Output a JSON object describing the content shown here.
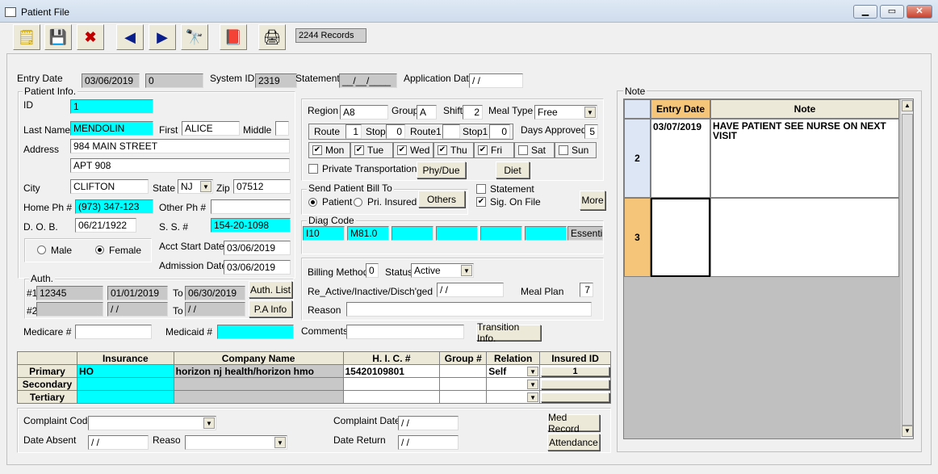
{
  "window": {
    "title": "Patient File",
    "min": "▭",
    "max": "□",
    "close": "✕"
  },
  "toolbar": {
    "records": "2244 Records"
  },
  "header": {
    "entry_date_label": "Entry Date",
    "entry_date": "03/06/2019",
    "entry_extra": "0",
    "system_id_label": "System ID",
    "system_id": "2319",
    "statement_label": "Statement",
    "statement": "__/__/____",
    "application_date_label": "Application Date",
    "application_date": " / /"
  },
  "patient": {
    "group_label": "Patient Info.",
    "id_label": "ID",
    "id": "1",
    "last_name_label": "Last Name",
    "last_name": "MENDOLIN",
    "first_label": "First",
    "first": "ALICE",
    "middle_label": "Middle",
    "middle": "",
    "address_label": "Address",
    "address1": "984 MAIN STREET",
    "address2": "APT 908",
    "city_label": "City",
    "city": "CLIFTON",
    "state_label": "State",
    "state": "NJ",
    "zip_label": "Zip",
    "zip": "07512",
    "home_ph_label": "Home Ph #",
    "home_ph": "(973) 347-123",
    "other_ph_label": "Other Ph #",
    "other_ph": "",
    "dob_label": "D. O. B.",
    "dob": "06/21/1922",
    "ss_label": "S. S. #",
    "ss": "154-20-1098",
    "male_label": "Male",
    "female_label": "Female",
    "acct_start_label": "Acct Start Date",
    "acct_start": "03/06/2019",
    "admission_label": "Admission Date",
    "admission": "03/06/2019"
  },
  "auth": {
    "group_label": "Auth.",
    "row1_label": "#1",
    "row1_num": "12345",
    "row1_from": "01/01/2019",
    "to_label": "To",
    "row1_to": "06/30/2019",
    "row2_label": "#2",
    "row2_num": "",
    "row2_from": " / /",
    "row2_to": " / /",
    "auth_list": "Auth. List",
    "pa_info": "P.A Info"
  },
  "medicare_label": "Medicare #",
  "medicare": "",
  "medicaid_label": "Medicaid #",
  "medicaid": "",
  "comments_label": "Comments",
  "comments": "",
  "transition_btn": "Transition Info.",
  "route": {
    "region_label": "Region",
    "region": "A8",
    "group_label": "Group",
    "group": "A",
    "shift_label": "Shift",
    "shift": "2",
    "meal_type_label": "Meal Type",
    "meal_type": "Free",
    "route_label": "Route",
    "route": "1",
    "stop_label": "Stop",
    "stop": "0",
    "route1_label": "Route1",
    "route1": "",
    "stop1_label": "Stop1",
    "stop1": "0",
    "days_approved_label": "Days Approved",
    "days_approved": "5",
    "days": [
      "Mon",
      "Tue",
      "Wed",
      "Thu",
      "Fri",
      "Sat",
      "Sun"
    ],
    "days_checked": [
      true,
      true,
      true,
      true,
      true,
      false,
      false
    ],
    "private_transport_label": "Private Transportation",
    "phy_due": "Phy/Due",
    "diet": "Diet"
  },
  "bill": {
    "group_label": "Send Patient Bill To",
    "patient_label": "Patient",
    "pri_insured_label": "Pri. Insured",
    "others": "Others",
    "statement_label": "Statement",
    "sig_label": "Sig. On File",
    "more": "More"
  },
  "diag": {
    "group_label": "Diag Code",
    "codes": [
      "I10",
      "M81.0",
      "",
      "",
      "",
      ""
    ],
    "desc": "Essential"
  },
  "billing": {
    "method_label": "Billing Method",
    "method": "0",
    "status_label": "Status",
    "status": "Active",
    "reactive_label": "Re_Active/Inactive/Disch'ged",
    "reactive": " / /",
    "meal_plan_label": "Meal Plan",
    "meal_plan": "7",
    "reason_label": "Reason",
    "reason": ""
  },
  "insurance": {
    "headers": [
      "Insurance",
      "Company Name",
      "H. I. C. #",
      "Group #",
      "Relation",
      "Insured ID"
    ],
    "rows": [
      {
        "label": "Primary",
        "insurance": "HO",
        "company": "horizon nj health/horizon hmo",
        "hic": "15420109801",
        "group": "",
        "relation": "Self",
        "insured_id": "1"
      },
      {
        "label": "Secondary",
        "insurance": "",
        "company": "",
        "hic": "",
        "group": "",
        "relation": "",
        "insured_id": ""
      },
      {
        "label": "Tertiary",
        "insurance": "",
        "company": "",
        "hic": "",
        "group": "",
        "relation": "",
        "insured_id": ""
      }
    ]
  },
  "complaint": {
    "code_label": "Complaint Code",
    "code": "",
    "date_label": "Complaint Date",
    "date": " / /",
    "absent_label": "Date Absent",
    "absent": " / /",
    "reason_label": "Reason",
    "reason": "",
    "return_label": "Date Return",
    "return": " / /",
    "med_record": "Med Record",
    "attendance": "Attendance"
  },
  "notes": {
    "group_label": "Note",
    "headers": [
      "Entry Date",
      "Note"
    ],
    "rows": [
      {
        "num": "2",
        "date": "03/07/2019",
        "note": "HAVE PATIENT SEE NURSE ON NEXT VISIT"
      },
      {
        "num": "3",
        "date": "",
        "note": ""
      }
    ]
  },
  "colors": {
    "accent": "#00ffff",
    "header_active": "#f5c67a"
  }
}
